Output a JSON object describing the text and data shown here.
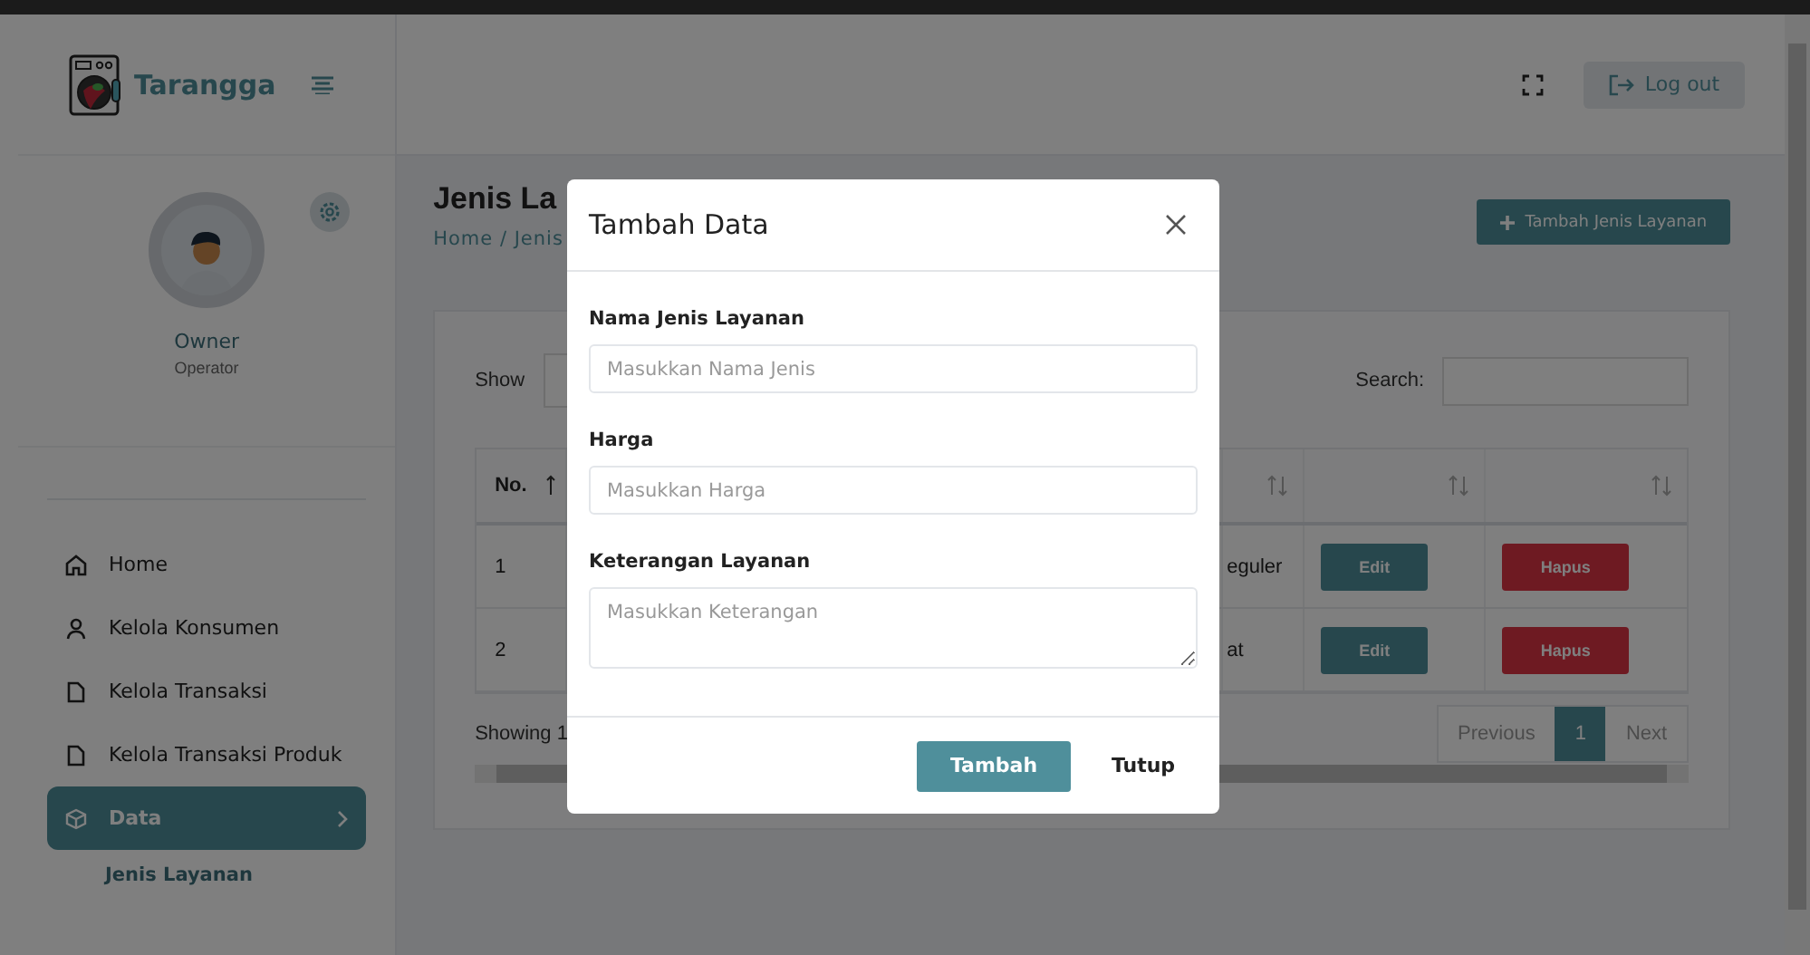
{
  "sidebar": {
    "brand": "Tarangga",
    "profile": {
      "name": "Owner",
      "role": "Operator"
    },
    "menu": [
      {
        "label": "Home",
        "kind": "home",
        "selected": false
      },
      {
        "label": "Kelola Konsumen",
        "kind": "user",
        "selected": false
      },
      {
        "label": "Kelola Transaksi",
        "kind": "file",
        "selected": false
      },
      {
        "label": "Kelola Transaksi Produk",
        "kind": "file",
        "selected": false
      },
      {
        "label": "Data",
        "kind": "box",
        "selected": true,
        "expanded": true,
        "children": [
          {
            "label": "Jenis Layanan"
          }
        ]
      }
    ]
  },
  "topbar": {
    "logout": "Log out"
  },
  "page": {
    "title": "Jenis La",
    "breadcrumb": "Home / Jenis",
    "add_button": "Tambah Jenis Layanan"
  },
  "table_controls": {
    "show_label": "Show",
    "search_label": "Search:"
  },
  "table": {
    "columns": [
      "No."
    ],
    "rows": [
      {
        "no": "1",
        "column_2": "eguler",
        "edit": "Edit",
        "delete": "Hapus"
      },
      {
        "no": "2",
        "column_2": "at",
        "edit": "Edit",
        "delete": "Hapus"
      }
    ]
  },
  "table_footer": {
    "info": "Showing 1",
    "pagination": [
      {
        "label": "Previous",
        "selected": false
      },
      {
        "label": "1",
        "selected": true
      },
      {
        "label": "Next",
        "selected": false
      }
    ]
  },
  "modal": {
    "title": "Tambah Data",
    "fields": [
      {
        "label": "Nama Jenis Layanan",
        "placeholder": "Masukkan Nama Jenis",
        "kind": "input"
      },
      {
        "label": "Harga",
        "placeholder": "Masukkan Harga",
        "kind": "input"
      },
      {
        "label": "Keterangan Layanan",
        "placeholder": "Masukkan Keterangan",
        "kind": "textarea"
      }
    ],
    "buttons": [
      {
        "label": "Tambah",
        "kind": "primary"
      },
      {
        "label": "Tutup",
        "kind": "plain"
      }
    ]
  }
}
